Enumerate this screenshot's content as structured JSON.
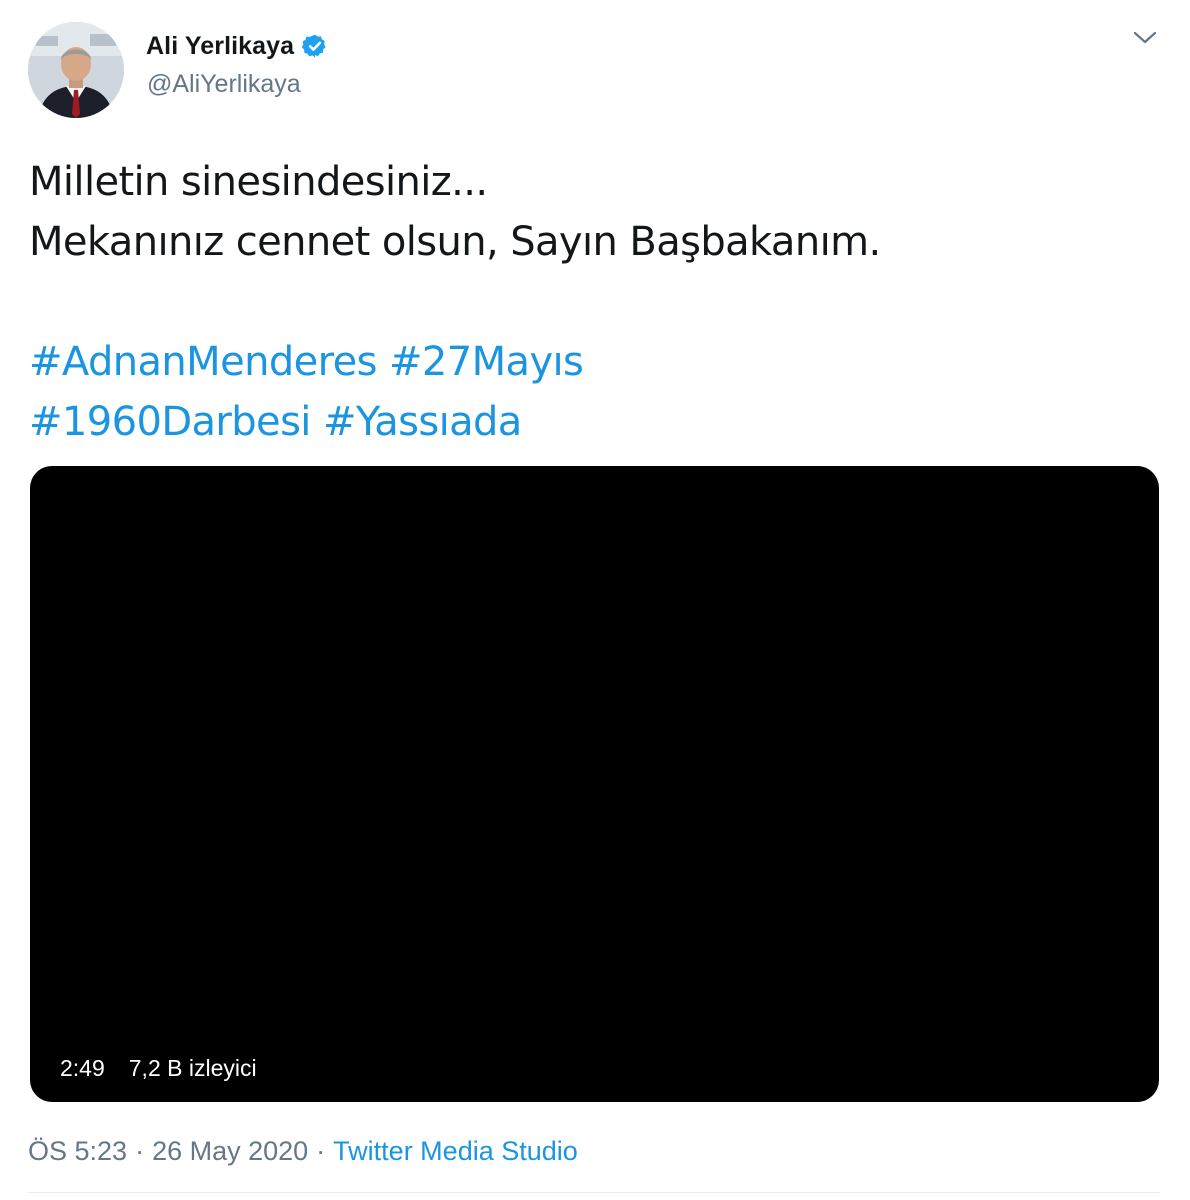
{
  "author": {
    "display_name": "Ali Yerlikaya",
    "handle": "@AliYerlikaya",
    "verified": true
  },
  "tweet": {
    "text_lines": [
      "Milletin sinesindesiniz...",
      "Mekanınız cennet olsun, Sayın Başbakanım."
    ],
    "hashtag_lines": [
      [
        "#AdnanMenderes",
        "#27Mayıs"
      ],
      [
        "#1960Darbesi",
        "#Yassıada"
      ]
    ]
  },
  "video": {
    "duration": "2:49",
    "views": "7,2 B izleyici"
  },
  "meta": {
    "time": "ÖS 5:23",
    "separator": "·",
    "date": "26 May 2020",
    "source": "Twitter Media Studio"
  },
  "colors": {
    "link": "#1b95e0",
    "secondary_text": "#657786",
    "verified": "#1da1f2",
    "video_background": "#000000"
  },
  "icons": {
    "more": "chevron-down-icon",
    "verified": "verified-badge-icon"
  }
}
